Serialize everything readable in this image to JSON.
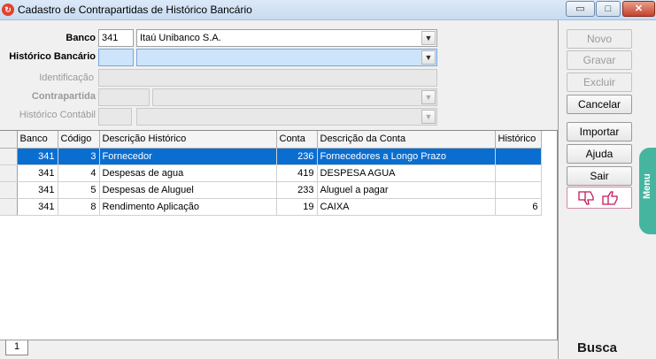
{
  "window": {
    "title": "Cadastro de Contrapartidas de Histórico Bancário",
    "min_glyph": "▭",
    "max_glyph": "□",
    "close_glyph": "✕"
  },
  "form": {
    "banco": {
      "label": "Banco",
      "code": "341",
      "name": "Itaú Unibanco S.A."
    },
    "historico": {
      "label": "Histórico Bancário",
      "code": "",
      "name": ""
    },
    "identificacao": {
      "label": "Identificação",
      "value": ""
    },
    "contrapartida": {
      "label": "Contrapartida",
      "code": "",
      "name": ""
    },
    "historico_contabil": {
      "label": "Histórico Contábil",
      "code": "",
      "name": ""
    }
  },
  "grid": {
    "columns": [
      "Banco",
      "Código",
      "Descrição Histórico",
      "Conta",
      "Descrição da Conta",
      "Histórico"
    ],
    "rows": [
      {
        "banco": "341",
        "codigo": "3",
        "descricao": "Fornecedor",
        "conta": "236",
        "descricao_conta": "Fornecedores a Longo Prazo",
        "historico": ""
      },
      {
        "banco": "341",
        "codigo": "4",
        "descricao": "Despesas de agua",
        "conta": "419",
        "descricao_conta": "DESPESA AGUA",
        "historico": ""
      },
      {
        "banco": "341",
        "codigo": "5",
        "descricao": "Despesas de Aluguel",
        "conta": "233",
        "descricao_conta": "Aluguel a pagar",
        "historico": ""
      },
      {
        "banco": "341",
        "codigo": "8",
        "descricao": "Rendimento Aplicação",
        "conta": "19",
        "descricao_conta": "CAIXA",
        "historico": "6"
      }
    ],
    "selected_row": 0
  },
  "tabs": {
    "page": "1"
  },
  "side": {
    "novo": "Novo",
    "gravar": "Gravar",
    "excluir": "Excluir",
    "cancelar": "Cancelar",
    "importar": "Importar",
    "ajuda": "Ajuda",
    "sair": "Sair",
    "menu": "Menu",
    "busca": "Busca"
  },
  "icons": {
    "dropdown": "chevron-down-icon",
    "thumbs_down": "thumbs-down-icon",
    "thumbs_up": "thumbs-up-icon"
  },
  "colors": {
    "selection": "#0a6ed1",
    "menu_tab": "#46b59f",
    "thumbs_border": "#d08aa8"
  }
}
